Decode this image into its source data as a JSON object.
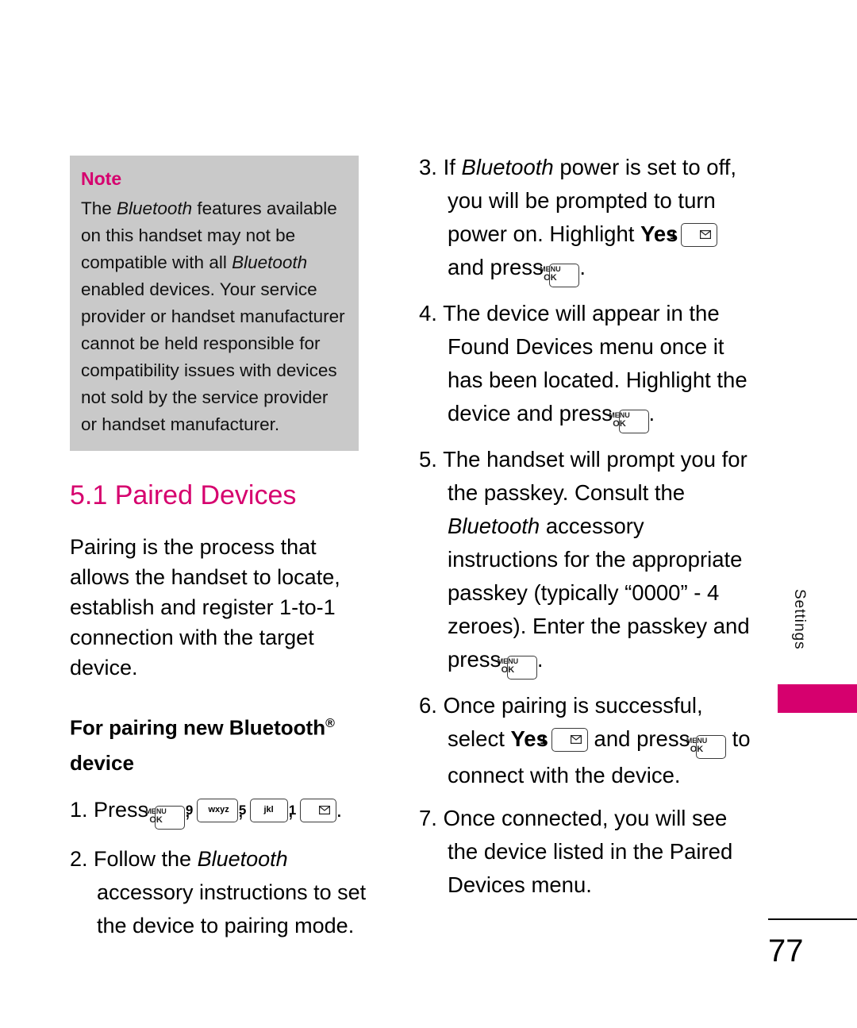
{
  "page": {
    "number": "77",
    "side_tab": "Settings",
    "accent_color": "#d6006e",
    "note_bg": "#c9c9c9"
  },
  "note": {
    "title": "Note",
    "text_1": "The ",
    "italic_1": "Bluetooth",
    "text_2": " features available on this handset may not be compatible with all ",
    "italic_2": "Bluetooth",
    "text_3": " enabled devices. Your service provider or handset manufacturer cannot be held responsible for compatibility issues with devices not sold by the service provider or handset manufacturer."
  },
  "section": {
    "heading": "5.1 Paired Devices",
    "paragraph": "Pairing is the process that allows the handset to locate, establish and register 1-to-1 connection with the target device.",
    "subheading_1": "For pairing new Bluetooth",
    "subheading_registered": "®",
    "subheading_2": "device"
  },
  "left_steps": {
    "step1_label": "1. Press",
    "step1_comma": ",",
    "step1_period": ".",
    "step2": "2. Follow the ",
    "step2_italic": "Bluetooth",
    "step2_rest": " accessory instructions to set the device to pairing mode."
  },
  "right_steps": {
    "step3_a": "3. If ",
    "step3_italic": "Bluetooth",
    "step3_b": " power is set to off, you will be prompted to turn power on. Highlight ",
    "step3_yes": "Yes",
    "step3_c": " and press",
    "step3_d": ".",
    "step4": "4. The device will appear in the Found Devices menu once it has been located. Highlight the device and press",
    "step4_end": ".",
    "step5_a": "5. The handset will prompt you for the passkey. Consult the ",
    "step5_italic": "Bluetooth",
    "step5_b": " accessory instructions for the appropriate passkey (typically “0000” - 4 zeroes). Enter the passkey and press",
    "step5_end": ".",
    "step6_a": "6. Once pairing is successful, select ",
    "step6_yes": "Yes",
    "step6_b": " and press",
    "step6_c": " to connect with the device.",
    "step7": "7. Once connected, you will see the device listed in the Paired Devices menu."
  },
  "keys": {
    "menu_top": "MENU",
    "menu_bottom": "OK",
    "num_9": "9",
    "num_9_sub": "wxyz",
    "num_5": "5",
    "num_5_sub": "jkl",
    "num_1": "1"
  }
}
